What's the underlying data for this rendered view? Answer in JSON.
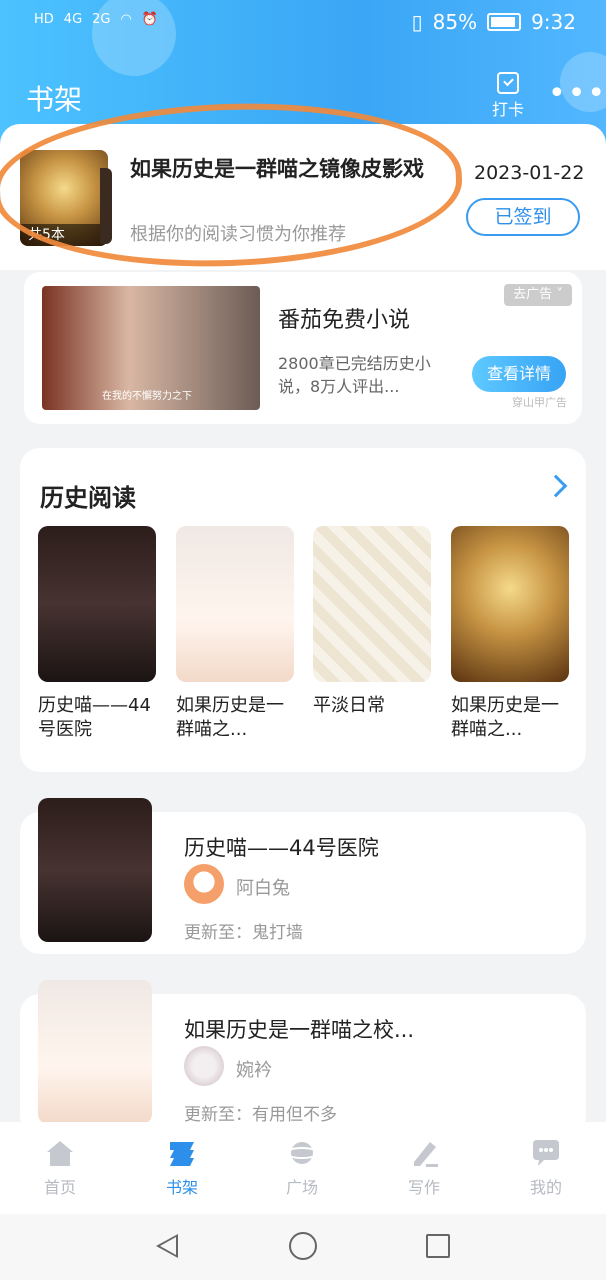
{
  "status_bar": {
    "left_indicators": [
      "HD",
      "4G",
      "2G"
    ],
    "battery": "85%",
    "time": "9:32"
  },
  "header": {
    "title": "书架",
    "checkin_label": "打卡",
    "more_icon": "more-dots-icon"
  },
  "recommended": {
    "title": "如果历史是一群喵之镜像皮影戏",
    "subtitle": "根据你的阅读习惯为你推荐",
    "cover_badge": "共5本",
    "date": "2023-01-22",
    "signed_button": "已签到"
  },
  "ad": {
    "title": "番茄免费小说",
    "description": "2800章已完结历史小说，8万人评出...",
    "tag": "去广告",
    "cta": "查看详情",
    "source": "穿山甲广告",
    "caption": "在我的不懈努力之下"
  },
  "history_section": {
    "title": "历史阅读",
    "books": [
      {
        "name": "历史喵——44号医院"
      },
      {
        "name": "如果历史是一群喵之..."
      },
      {
        "name": "平淡日常"
      },
      {
        "name": "如果历史是一群喵之..."
      }
    ]
  },
  "shelf": [
    {
      "title": "历史喵——44号医院",
      "author": "阿白兔",
      "update": "更新至：鬼打墙"
    },
    {
      "title": "如果历史是一群喵之校...",
      "author": "婉衿",
      "update": "更新至：有用但不多"
    }
  ],
  "tabbar": {
    "items": [
      {
        "label": "首页",
        "icon": "home-icon"
      },
      {
        "label": "书架",
        "icon": "bookshelf-icon",
        "active": true
      },
      {
        "label": "广场",
        "icon": "planet-icon"
      },
      {
        "label": "写作",
        "icon": "pen-icon"
      },
      {
        "label": "我的",
        "icon": "chat-bubble-icon"
      }
    ]
  },
  "colors": {
    "accent": "#2d8fea",
    "header_start": "#4cc2ff",
    "highlight_stroke": "#f08a3c"
  }
}
